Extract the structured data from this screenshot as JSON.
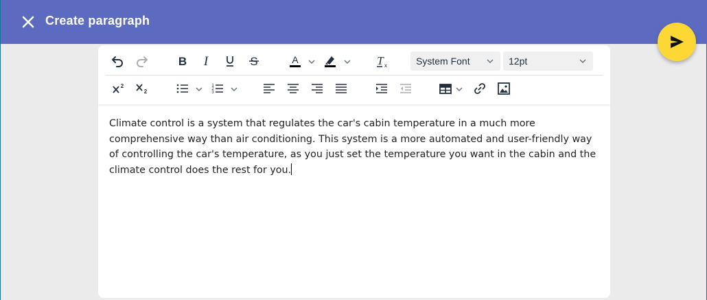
{
  "header": {
    "title": "Create paragraph",
    "background_color": "#5c6bc0",
    "close_icon": "close-icon"
  },
  "fab": {
    "icon": "send-icon",
    "color": "#fdd835"
  },
  "toolbar": {
    "font_family": "System Font",
    "font_size": "12pt",
    "row1_icons": [
      "undo-icon",
      "redo-icon",
      "bold-icon",
      "italic-icon",
      "underline-icon",
      "strikethrough-icon",
      "text-color-icon",
      "highlight-color-icon",
      "clear-formatting-icon"
    ],
    "row2_icons": [
      "superscript-icon",
      "subscript-icon",
      "bullet-list-icon",
      "numbered-list-icon",
      "align-left-icon",
      "align-center-icon",
      "align-right-icon",
      "justify-icon",
      "indent-icon",
      "outdent-icon",
      "table-icon",
      "link-icon",
      "image-icon"
    ]
  },
  "editor": {
    "text": "Climate control is a system that regulates the car's cabin temperature in a much more comprehensive way than air conditioning. This system is a more automated and user-friendly way of controlling the car's temperature, as you just set the temperature you want in the cabin and the climate control does the rest for you."
  }
}
